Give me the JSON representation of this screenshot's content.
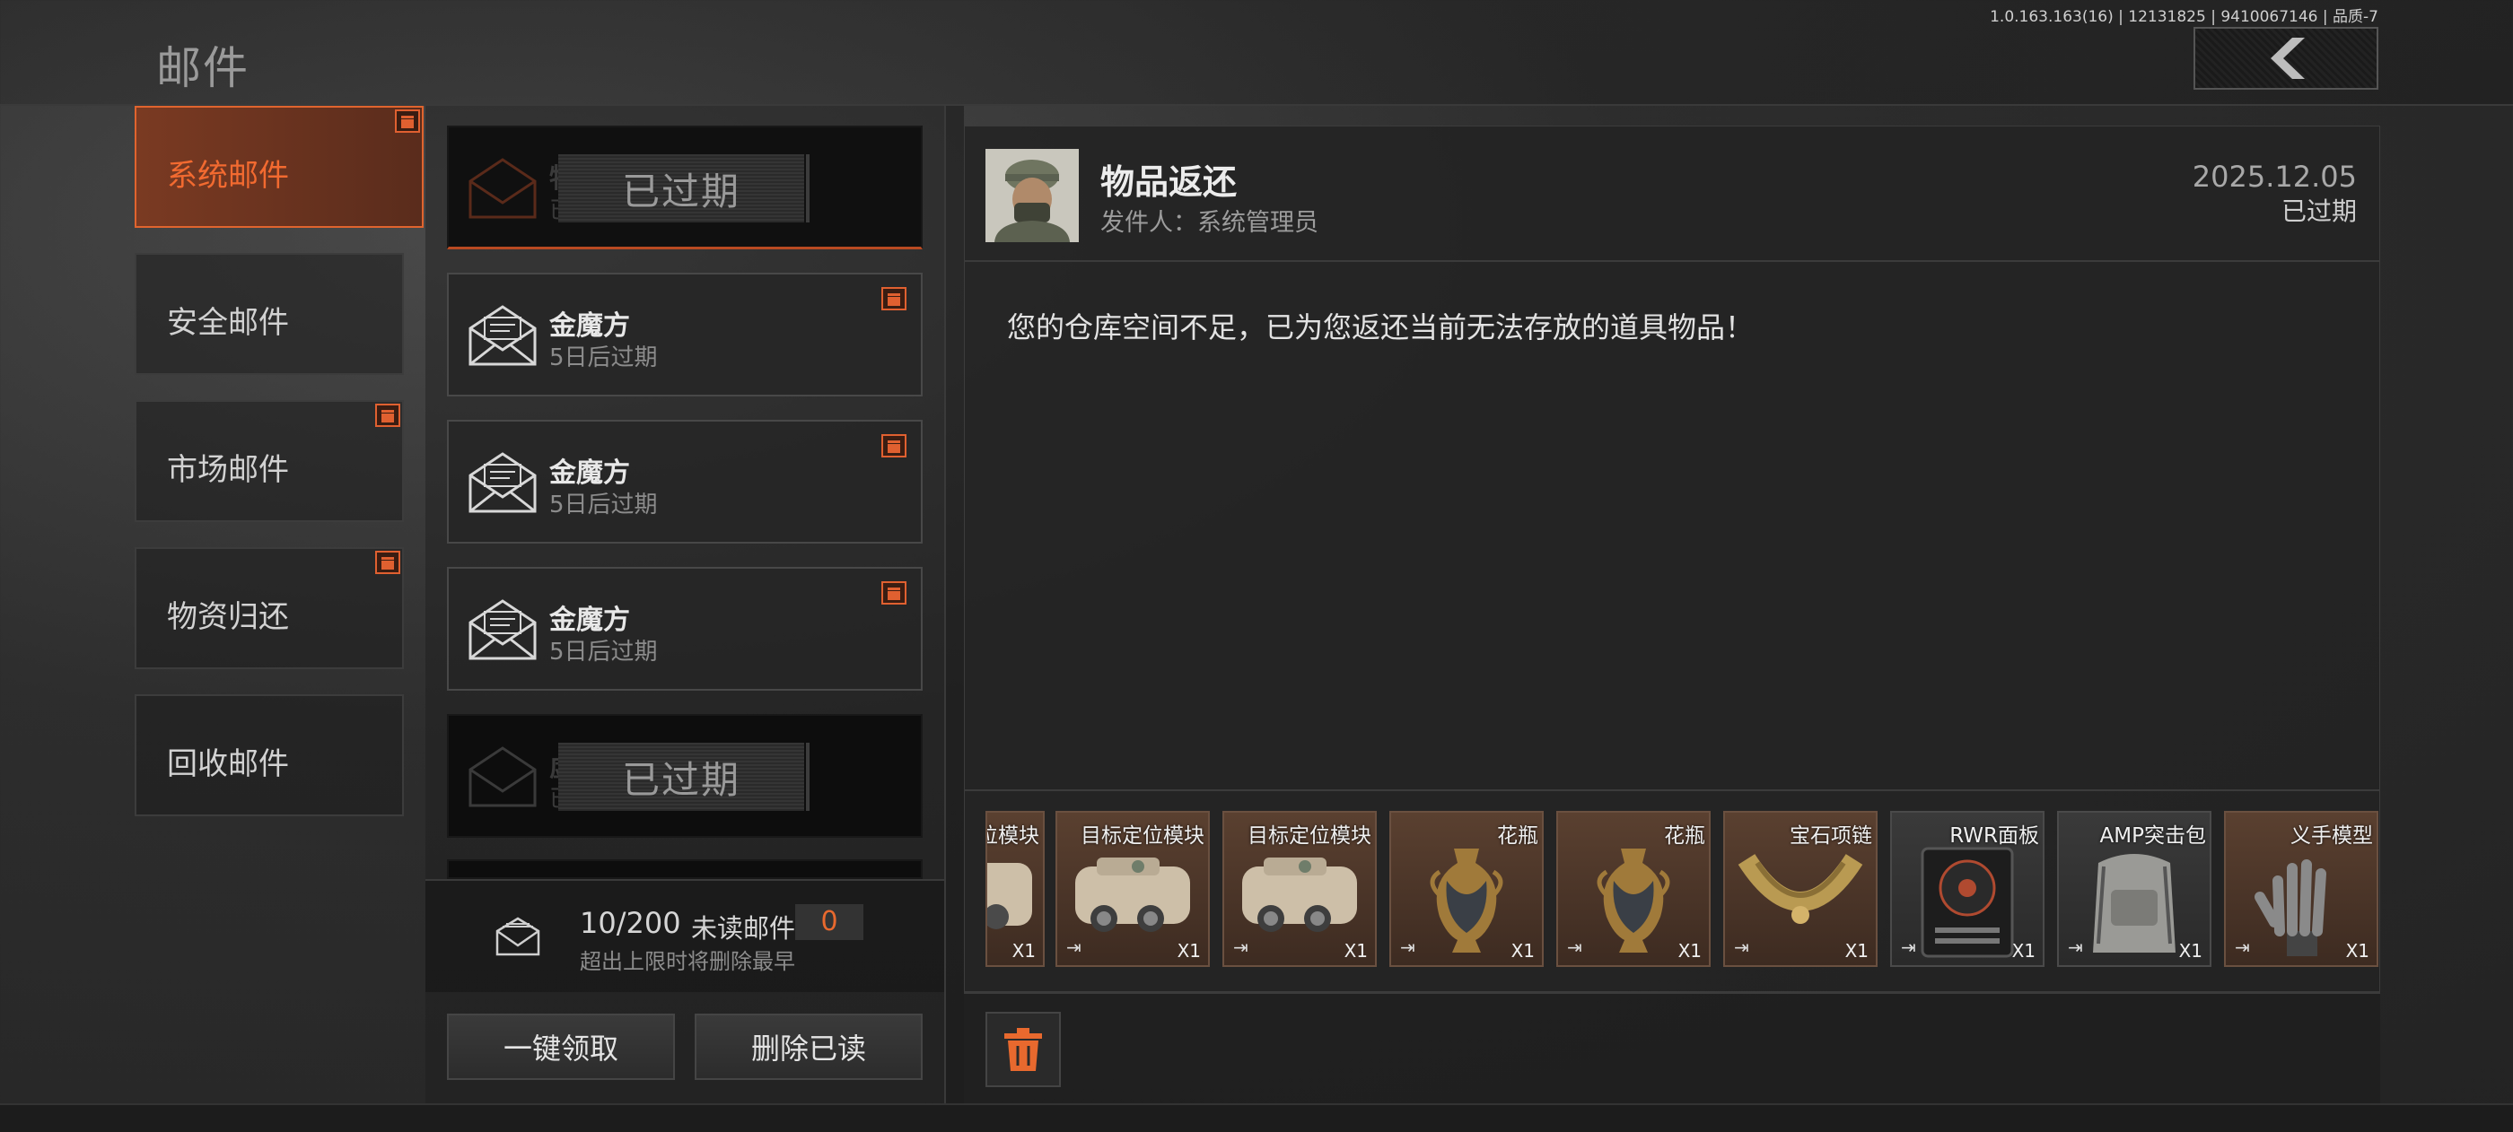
{
  "version": "1.0.163.163(16) | 12131825 | 9410067146 | 品质-7",
  "page_title": "邮件",
  "categories": [
    {
      "label": "系统邮件",
      "active": true,
      "gift": true
    },
    {
      "label": "安全邮件",
      "active": false,
      "gift": false
    },
    {
      "label": "市场邮件",
      "active": false,
      "gift": true
    },
    {
      "label": "物资归还",
      "active": false,
      "gift": true
    },
    {
      "label": "回收邮件",
      "active": false,
      "gift": false
    }
  ],
  "mails": [
    {
      "title": "物",
      "subtitle": "已",
      "expired_label": "已过期",
      "expired": true,
      "selected": true
    },
    {
      "title": "金魔方",
      "subtitle": "5日后过期",
      "expired": false,
      "gift": true
    },
    {
      "title": "金魔方",
      "subtitle": "5日后过期",
      "expired": false,
      "gift": true
    },
    {
      "title": "金魔方",
      "subtitle": "5日后过期",
      "expired": false,
      "gift": true
    },
    {
      "title": "虚",
      "subtitle": "已",
      "expired_label": "已过期",
      "expired": true
    }
  ],
  "counter": {
    "count": "10/200",
    "unread_label": "未读邮件",
    "unread_count": "0",
    "hint": "超出上限时将删除最早"
  },
  "buttons": {
    "claim_all": "一键领取",
    "delete_read": "删除已读"
  },
  "detail": {
    "title": "物品返还",
    "sender": "发件人：系统管理员",
    "date": "2025.12.05",
    "status": "已过期",
    "body": "您的仓库空间不足，已为您返还当前无法存放的道具物品！"
  },
  "items": [
    {
      "name": "位模块",
      "qty": "X1",
      "icon": "laser-module-icon"
    },
    {
      "name": "目标定位模块",
      "qty": "X1",
      "icon": "laser-module-icon"
    },
    {
      "name": "目标定位模块",
      "qty": "X1",
      "icon": "laser-module-icon"
    },
    {
      "name": "花瓶",
      "qty": "X1",
      "icon": "vase-icon"
    },
    {
      "name": "花瓶",
      "qty": "X1",
      "icon": "vase-icon"
    },
    {
      "name": "宝石项链",
      "qty": "X1",
      "icon": "necklace-icon"
    },
    {
      "name": "RWR面板",
      "qty": "X1",
      "icon": "rwr-panel-icon"
    },
    {
      "name": "AMP突击包",
      "qty": "X1",
      "icon": "backpack-icon"
    },
    {
      "name": "义手模型",
      "qty": "X1",
      "icon": "prosthetic-hand-icon"
    }
  ],
  "colors": {
    "accent": "#e8692e",
    "active_tab_bg": "#6a3220",
    "panel_bg": "#242424"
  }
}
